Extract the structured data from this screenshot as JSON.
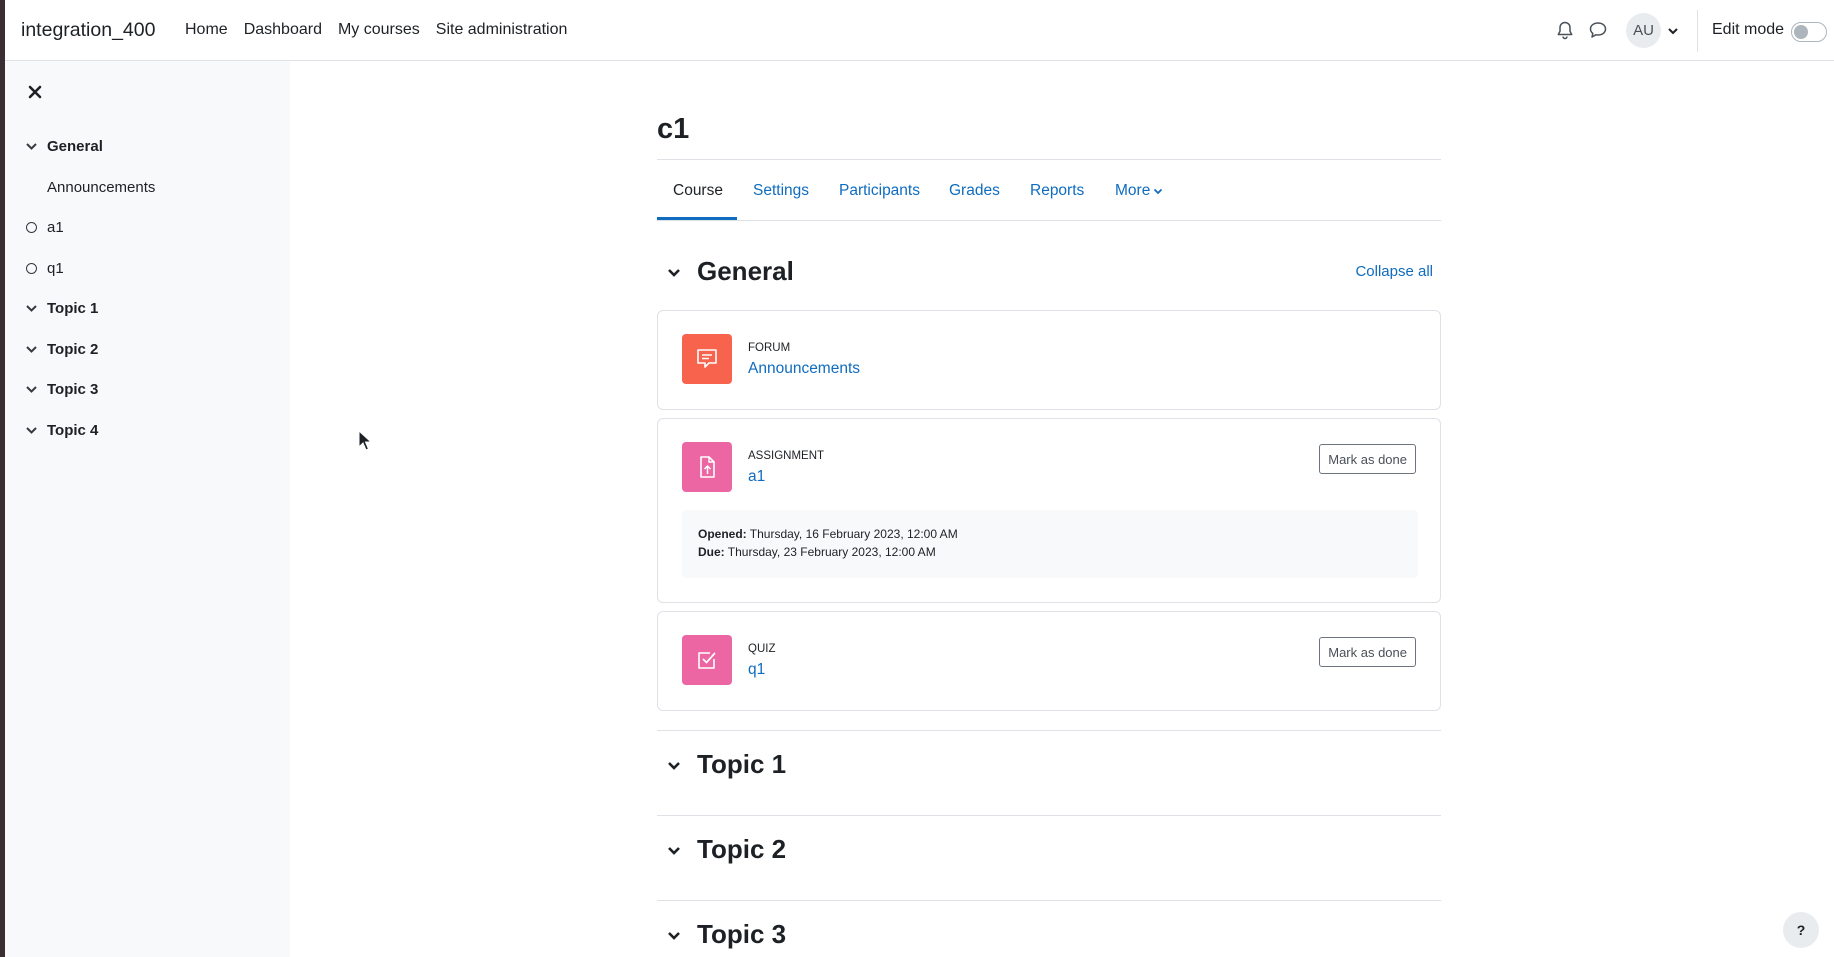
{
  "navbar": {
    "brand": "integration_400",
    "links": [
      "Home",
      "Dashboard",
      "My courses",
      "Site administration"
    ],
    "avatar_initials": "AU",
    "edit_mode_label": "Edit mode",
    "edit_mode_on": false
  },
  "drawer": {
    "items": [
      {
        "label": "General",
        "kind": "section"
      },
      {
        "label": "Announcements",
        "kind": "activity-noicon"
      },
      {
        "label": "a1",
        "kind": "activity"
      },
      {
        "label": "q1",
        "kind": "activity"
      },
      {
        "label": "Topic 1",
        "kind": "section"
      },
      {
        "label": "Topic 2",
        "kind": "section"
      },
      {
        "label": "Topic 3",
        "kind": "section"
      },
      {
        "label": "Topic 4",
        "kind": "section"
      }
    ]
  },
  "course": {
    "title": "c1",
    "tabs": [
      "Course",
      "Settings",
      "Participants",
      "Grades",
      "Reports",
      "More"
    ],
    "active_tab": "Course",
    "collapse_all": "Collapse all",
    "sections": [
      "General",
      "Topic 1",
      "Topic 2",
      "Topic 3"
    ],
    "activities": [
      {
        "type": "Forum",
        "name": "Announcements",
        "icon": "forum-icon",
        "color": "#f7634d"
      },
      {
        "type": "Assignment",
        "name": "a1",
        "icon": "assignment-icon",
        "color": "#eb66a2",
        "mark_label": "Mark as done",
        "opened_label": "Opened:",
        "opened_value": " Thursday, 16 February 2023, 12:00 AM",
        "due_label": "Due:",
        "due_value": " Thursday, 23 February 2023, 12:00 AM"
      },
      {
        "type": "Quiz",
        "name": "q1",
        "icon": "quiz-icon",
        "color": "#eb66a2",
        "mark_label": "Mark as done"
      }
    ]
  },
  "help_button": "?",
  "colors": {
    "link": "#0f6cbf",
    "border": "#dee2e6",
    "drawer_bg": "#f8f9fa"
  }
}
